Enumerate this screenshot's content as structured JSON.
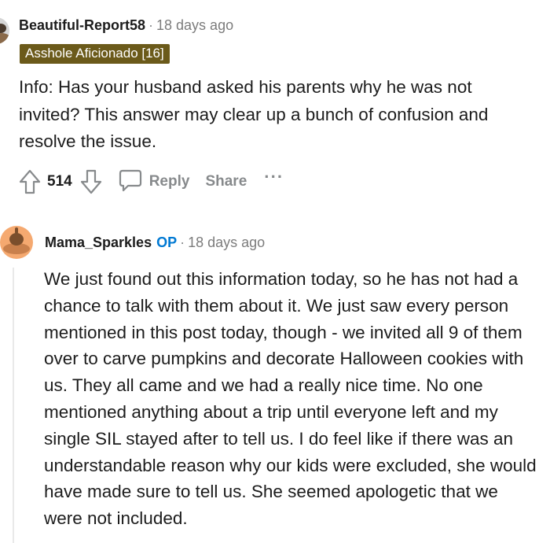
{
  "comments": [
    {
      "username": "Beautiful-Report58",
      "time": "18 days ago",
      "flair": "Asshole Aficionado [16]",
      "body": "Info: Has your husband asked his parents why he was not invited? This answer may clear up a bunch of confusion and resolve the issue.",
      "actions": {
        "votes": "514",
        "reply_label": "Reply",
        "share_label": "Share",
        "more_label": "···"
      }
    },
    {
      "username": "Mama_Sparkles",
      "op_badge": "OP",
      "time": "18 days ago",
      "body": "We just found out this information today, so he has not had a chance to talk with them about it. We just saw every person mentioned in this post today, though - we invited all 9 of them over to carve pumpkins and decorate Halloween cookies with us. They all came and we had a really nice time. No one mentioned anything about a trip until everyone left and my single SIL stayed after to tell us. I do feel like if there was an understandable reason why our kids were excluded, she would have made sure to tell us. She seemed apologetic that we were not included."
    }
  ],
  "meta": {
    "separator": "·"
  },
  "colors": {
    "flair_bg": "#6b5a1a",
    "op_blue": "#0079d3",
    "muted": "#878a8c"
  },
  "icons": [
    "upvote-icon",
    "downvote-icon",
    "comment-bubble-icon",
    "avatar-snoo"
  ]
}
